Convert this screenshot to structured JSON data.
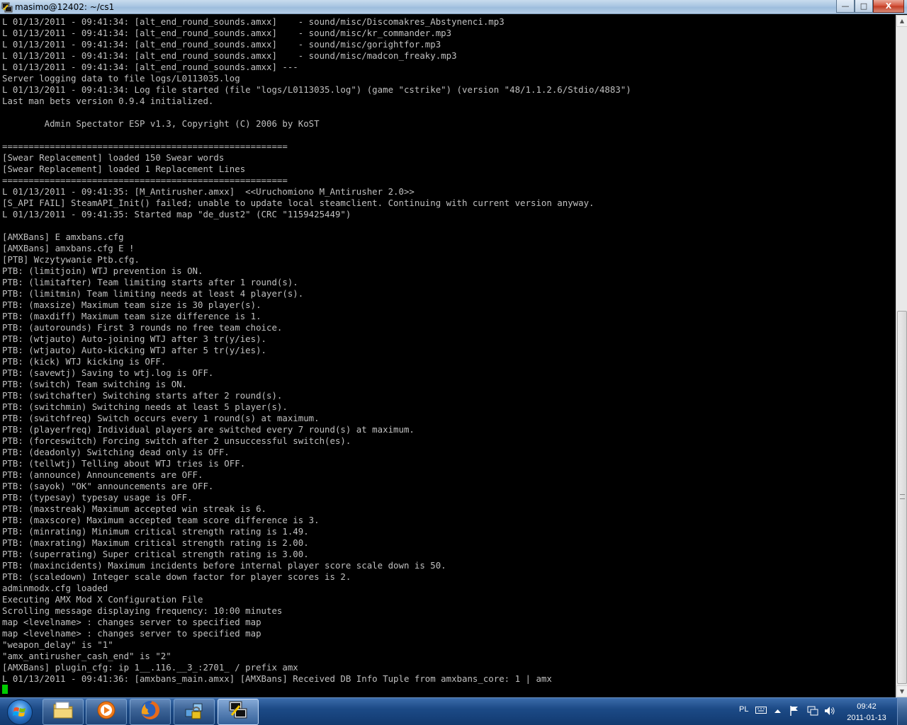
{
  "window": {
    "title": "masimo@12402: ~/cs1",
    "buttons": {
      "minimize": "—",
      "maximize": "□",
      "close": "X"
    }
  },
  "terminal": {
    "lines": [
      "L 01/13/2011 - 09:41:34: [alt_end_round_sounds.amxx]    - sound/misc/Discomakres_Abstynenci.mp3",
      "L 01/13/2011 - 09:41:34: [alt_end_round_sounds.amxx]    - sound/misc/kr_commander.mp3",
      "L 01/13/2011 - 09:41:34: [alt_end_round_sounds.amxx]    - sound/misc/gorightfor.mp3",
      "L 01/13/2011 - 09:41:34: [alt_end_round_sounds.amxx]    - sound/misc/madcon_freaky.mp3",
      "L 01/13/2011 - 09:41:34: [alt_end_round_sounds.amxx] ---",
      "Server logging data to file logs/L0113035.log",
      "L 01/13/2011 - 09:41:34: Log file started (file \"logs/L0113035.log\") (game \"cstrike\") (version \"48/1.1.2.6/Stdio/4883\")",
      "Last man bets version 0.9.4 initialized.",
      "",
      "        Admin Spectator ESP v1.3, Copyright (C) 2006 by KoST",
      "",
      "======================================================",
      "[Swear Replacement] loaded 150 Swear words",
      "[Swear Replacement] loaded 1 Replacement Lines",
      "======================================================",
      "L 01/13/2011 - 09:41:35: [M_Antirusher.amxx]  <<Uruchomiono M_Antirusher 2.0>>",
      "[S_API FAIL] SteamAPI_Init() failed; unable to update local steamclient. Continuing with current version anyway.",
      "L 01/13/2011 - 09:41:35: Started map \"de_dust2\" (CRC \"1159425449\")",
      "",
      "[AMXBans] E amxbans.cfg",
      "[AMXBans] amxbans.cfg E !",
      "[PTB] Wczytywanie Ptb.cfg.",
      "PTB: (limitjoin) WTJ prevention is ON.",
      "PTB: (limitafter) Team limiting starts after 1 round(s).",
      "PTB: (limitmin) Team limiting needs at least 4 player(s).",
      "PTB: (maxsize) Maximum team size is 30 player(s).",
      "PTB: (maxdiff) Maximum team size difference is 1.",
      "PTB: (autorounds) First 3 rounds no free team choice.",
      "PTB: (wtjauto) Auto-joining WTJ after 3 tr(y/ies).",
      "PTB: (wtjauto) Auto-kicking WTJ after 5 tr(y/ies).",
      "PTB: (kick) WTJ kicking is OFF.",
      "PTB: (savewtj) Saving to wtj.log is OFF.",
      "PTB: (switch) Team switching is ON.",
      "PTB: (switchafter) Switching starts after 2 round(s).",
      "PTB: (switchmin) Switching needs at least 5 player(s).",
      "PTB: (switchfreq) Switch occurs every 1 round(s) at maximum.",
      "PTB: (playerfreq) Individual players are switched every 7 round(s) at maximum.",
      "PTB: (forceswitch) Forcing switch after 2 unsuccessful switch(es).",
      "PTB: (deadonly) Switching dead only is OFF.",
      "PTB: (tellwtj) Telling about WTJ tries is OFF.",
      "PTB: (announce) Announcements are OFF.",
      "PTB: (sayok) \"OK\" announcements are OFF.",
      "PTB: (typesay) typesay usage is OFF.",
      "PTB: (maxstreak) Maximum accepted win streak is 6.",
      "PTB: (maxscore) Maximum accepted team score difference is 3.",
      "PTB: (minrating) Minimum critical strength rating is 1.49.",
      "PTB: (maxrating) Maximum critical strength rating is 2.00.",
      "PTB: (superrating) Super critical strength rating is 3.00.",
      "PTB: (maxincidents) Maximum incidents before internal player score scale down is 50.",
      "PTB: (scaledown) Integer scale down factor for player scores is 2.",
      "adminmodx.cfg loaded",
      "Executing AMX Mod X Configuration File",
      "Scrolling message displaying frequency: 10:00 minutes",
      "map <levelname> : changes server to specified map",
      "map <levelname> : changes server to specified map",
      "\"weapon_delay\" is \"1\"",
      "\"amx_antirusher_cash_end\" is \"2\"",
      "[AMXBans] plugin_cfg: ip 1__.116.__3_:2701_ / prefix amx",
      "L 01/13/2011 - 09:41:36: [amxbans_main.amxx] [AMXBans] Received DB Info Tuple from amxbans_core: 1 | amx"
    ],
    "colors": {
      "background": "#000000",
      "text": "#c0c0c0",
      "cursor": "#00cc00"
    }
  },
  "scrollbar": {
    "up_arrow": "▲",
    "down_arrow": "▼"
  },
  "taskbar": {
    "apps": [
      {
        "name": "Windows Explorer",
        "icon": "folder-icon"
      },
      {
        "name": "Windows Media Player",
        "icon": "media-player-icon"
      },
      {
        "name": "Firefox",
        "icon": "firefox-icon"
      },
      {
        "name": "Network tool",
        "icon": "lock-network-icon"
      },
      {
        "name": "PuTTY",
        "icon": "putty-icon"
      }
    ],
    "tray": {
      "language": "PL",
      "time": "09:42",
      "date": "2011-01-13"
    }
  }
}
